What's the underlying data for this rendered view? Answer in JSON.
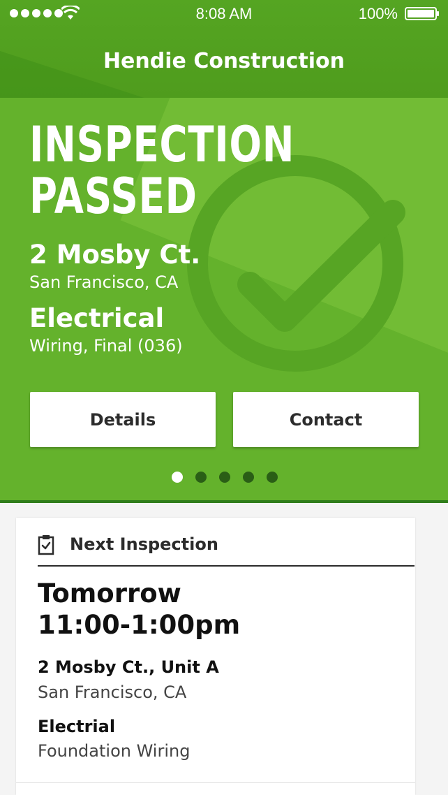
{
  "status_bar": {
    "time": "8:08 AM",
    "battery": "100%"
  },
  "app": {
    "title": "Hendie Construction"
  },
  "result": {
    "headline_line1": "INSPECTION",
    "headline_line2": "PASSED",
    "address": "2 Mosby Ct.",
    "city": "San Francisco, CA",
    "type": "Electrical",
    "subtype": "Wiring, Final (036)"
  },
  "actions": {
    "details_label": "Details",
    "contact_label": "Contact"
  },
  "pager": {
    "count": 5,
    "active_index": 0
  },
  "next_inspection": {
    "header": "Next Inspection",
    "when_line1": "Tomorrow",
    "when_line2": "11:00-1:00pm",
    "address": "2 Mosby Ct., Unit A",
    "city": "San Francisco, CA",
    "type": "Electrial",
    "subtype": "Foundation Wiring"
  },
  "colors": {
    "hero_green": "#6cb52f",
    "header_green": "#4f9c1d",
    "dark_green": "#2f7d1a"
  }
}
